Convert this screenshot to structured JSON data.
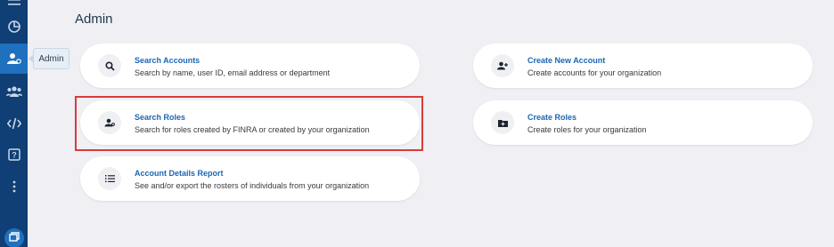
{
  "page": {
    "title": "Admin"
  },
  "sidebar": {
    "tooltip": "Admin",
    "items": [
      {
        "name": "menu-icon"
      },
      {
        "name": "dashboard-icon"
      },
      {
        "name": "admin-icon",
        "active": true
      },
      {
        "name": "users-icon"
      },
      {
        "name": "code-icon"
      },
      {
        "name": "help-icon"
      },
      {
        "name": "more-icon"
      },
      {
        "name": "windows-icon"
      }
    ]
  },
  "cards": {
    "search_accounts": {
      "title": "Search Accounts",
      "desc": "Search by name, user ID, email address or department",
      "icon": "search-icon"
    },
    "search_roles": {
      "title": "Search Roles",
      "desc": "Search for roles created by FINRA or created by your organization",
      "icon": "role-search-icon"
    },
    "account_details_report": {
      "title": "Account Details Report",
      "desc": "See and/or export the rosters of individuals from your organization",
      "icon": "list-icon"
    },
    "create_new_account": {
      "title": "Create New Account",
      "desc": "Create accounts for your organization",
      "icon": "add-user-icon"
    },
    "create_roles": {
      "title": "Create Roles",
      "desc": "Create roles for your organization",
      "icon": "folder-icon"
    }
  },
  "colors": {
    "sidebar": "#0f3f74",
    "sidebar_active": "#1f70bf",
    "link": "#1a66b5",
    "background": "#efeff4",
    "highlight": "#d93b3b"
  }
}
